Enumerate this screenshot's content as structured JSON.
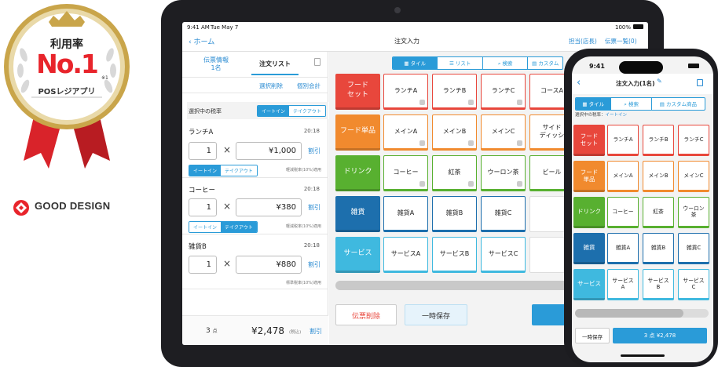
{
  "badge": {
    "rate_label": "利用率",
    "rank": "No.1",
    "footnote": "※1",
    "subtitle": "POSレジアプリ",
    "gold": "#c9a54a",
    "ribbon_red": "#d9232a"
  },
  "good_design": {
    "label": "GOOD DESIGN",
    "mark_color": "#e8242b"
  },
  "tablet": {
    "status": {
      "time": "9:41 AM",
      "date": "Tue May 7",
      "battery": "100%"
    },
    "nav": {
      "back": "ホーム",
      "title": "注文入力",
      "staff": "担当(店長)",
      "list": "伝票一覧(0)"
    },
    "left": {
      "tab_info": "伝票情報",
      "tab_info_count": "1名",
      "tab_order": "注文リスト",
      "delete_selected": "選択削除",
      "split_bill": "個別会計",
      "tax_rate_label": "選択中の税率",
      "eat_in": "イートイン",
      "takeout": "テイクアウト",
      "times": "×",
      "items": [
        {
          "name": "ランチA",
          "time": "20:18",
          "qty": "1",
          "price": "¥1,000",
          "discount": "割引",
          "tax_note": "軽減税率(10%)適用",
          "mode": "eatin"
        },
        {
          "name": "コーヒー",
          "time": "20:18",
          "qty": "1",
          "price": "¥380",
          "discount": "割引",
          "tax_note": "軽減税率(10%)適用",
          "mode": "takeout"
        },
        {
          "name": "雑貨B",
          "time": "20:18",
          "qty": "1",
          "price": "¥880",
          "discount": "割引",
          "tax_note": "標準税率(10%)適用",
          "mode": ""
        }
      ],
      "footer": {
        "count": "3",
        "count_unit": "点",
        "total": "¥2,478",
        "tax_incl": "(税込)",
        "discount": "割引"
      }
    },
    "right": {
      "view_tabs": [
        "タイル",
        "リスト",
        "検索",
        "カスタム"
      ],
      "categories": [
        {
          "label": "フード\nセット",
          "items": [
            "ランチA",
            "ランチB",
            "ランチC",
            "コースA"
          ]
        },
        {
          "label": "フード単品",
          "items": [
            "メインA",
            "メインB",
            "メインC",
            "サイド\nディッシ"
          ]
        },
        {
          "label": "ドリンク",
          "items": [
            "コーヒー",
            "紅茶",
            "ウーロン茶",
            "ビール"
          ]
        },
        {
          "label": "雑貨",
          "items": [
            "雑貨A",
            "雑貨B",
            "雑貨C"
          ]
        },
        {
          "label": "サービス",
          "items": [
            "サービスA",
            "サービスB",
            "サービスC"
          ]
        }
      ],
      "delete_slip": "伝票削除",
      "hold": "一時保存"
    }
  },
  "phone": {
    "time": "9:41",
    "title": "注文入力(1名)",
    "view_tabs": [
      "タイル",
      "検索",
      "カスタム商品"
    ],
    "tax_rate_label": "選択中の税率：",
    "tax_rate_value": "イートイン",
    "categories": [
      {
        "label": "フード\nセット",
        "items": [
          "ランチA",
          "ランチB",
          "ランチC"
        ]
      },
      {
        "label": "フード\n単品",
        "items": [
          "メインA",
          "メインB",
          "メインC"
        ]
      },
      {
        "label": "ドリンク",
        "items": [
          "コーヒー",
          "紅茶",
          "ウーロン\n茶"
        ]
      },
      {
        "label": "雑貨",
        "items": [
          "雑貨A",
          "雑貨B",
          "雑貨C"
        ]
      },
      {
        "label": "サービス",
        "items": [
          "サービス\nA",
          "サービス\nB",
          "サービス\nC"
        ]
      }
    ],
    "hold": "一時保存",
    "checkout": "3 点 ¥2,478"
  },
  "colors": {
    "accent": "#2a9bd8",
    "red": "#e8473c",
    "orange": "#f18a2e",
    "green": "#58b030",
    "blue": "#1d6fad",
    "cyan": "#3fb9df"
  }
}
